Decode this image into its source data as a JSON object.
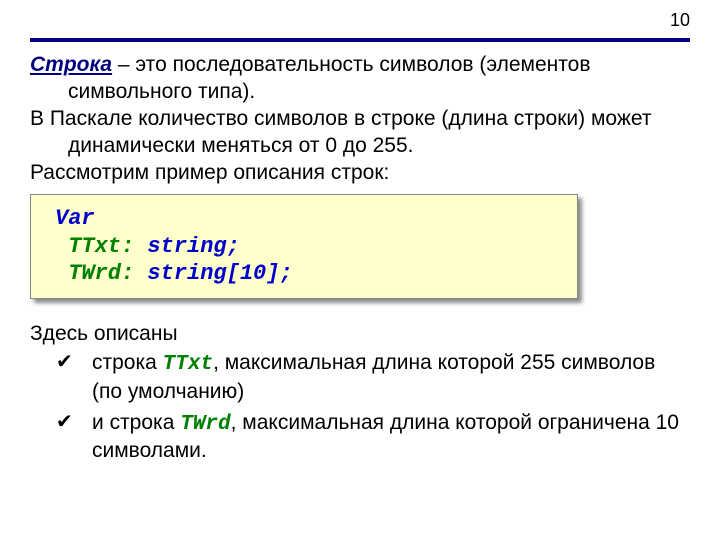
{
  "page_number": "10",
  "term": "Строка",
  "def_part1": " – это последовательность символов (элементов символьного типа).",
  "para2": "В Паскале количество символов в строке (длина строки) может динамически меняться от 0 до 255.",
  "para3": "Рассмотрим пример описания строк:",
  "code": {
    "kw_var": "Var",
    "l2_id": " TTxt:",
    "l2_type": " string;",
    "l3_id": " TWrd:",
    "l3_type": " string[10];"
  },
  "after_intro": "Здесь описаны",
  "b1_pre": "строка ",
  "b1_id": "TTxt",
  "b1_post": ", максимальная длина которой 255 символов (по умолчанию)",
  "b2_pre": "и строка ",
  "b2_id": "TWrd",
  "b2_post": ", максимальная длина которой ограничена 10 символами."
}
